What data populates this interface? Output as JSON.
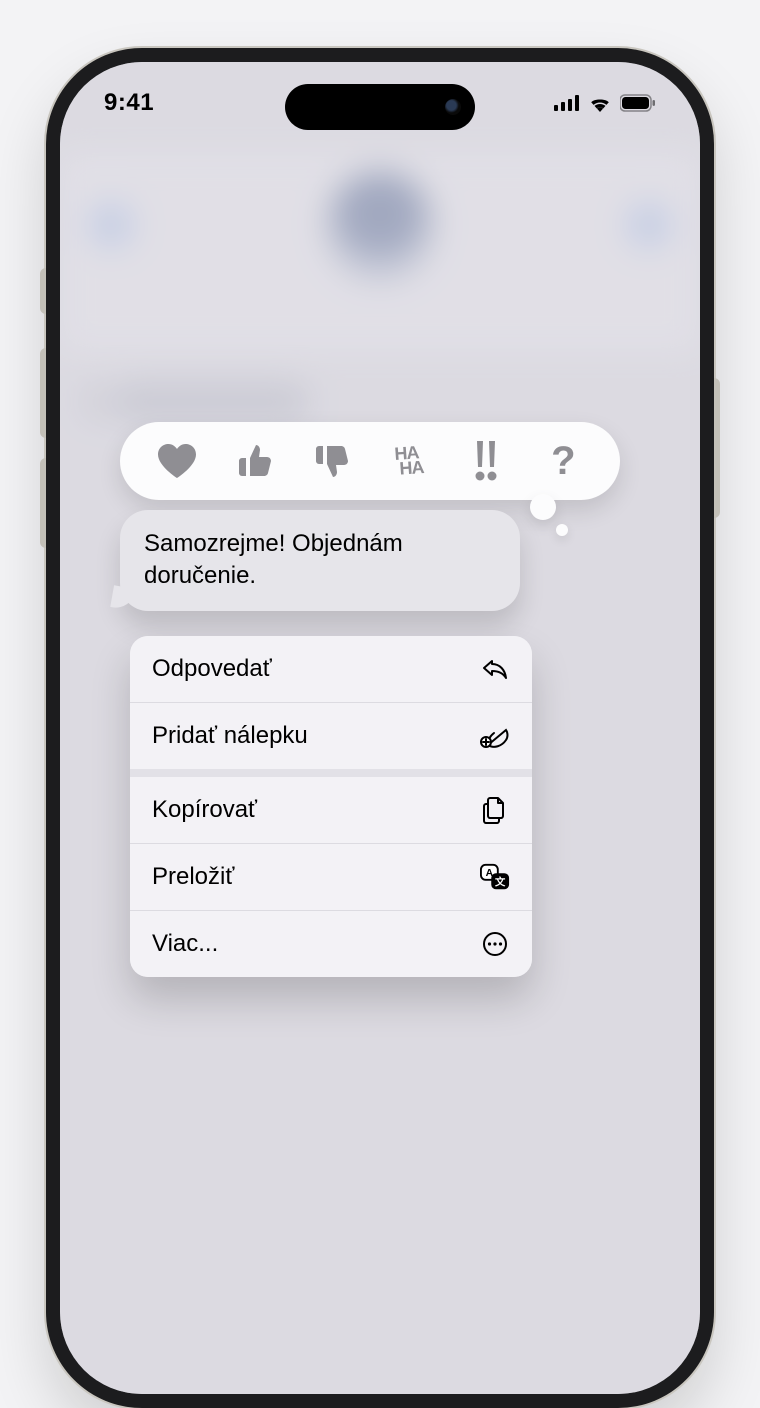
{
  "statusbar": {
    "time": "9:41"
  },
  "message": {
    "text": "Samozrejme! Objednám doručenie."
  },
  "tapbacks": {
    "heart": "heart",
    "thumbs_up": "thumbs-up",
    "thumbs_down": "thumbs-down",
    "haha": "HA HA",
    "exclaim": "!!",
    "question": "?"
  },
  "menu": {
    "reply": "Odpovedať",
    "add_sticker": "Pridať nálepku",
    "copy": "Kopírovať",
    "translate": "Preložiť",
    "more": "Viac..."
  }
}
